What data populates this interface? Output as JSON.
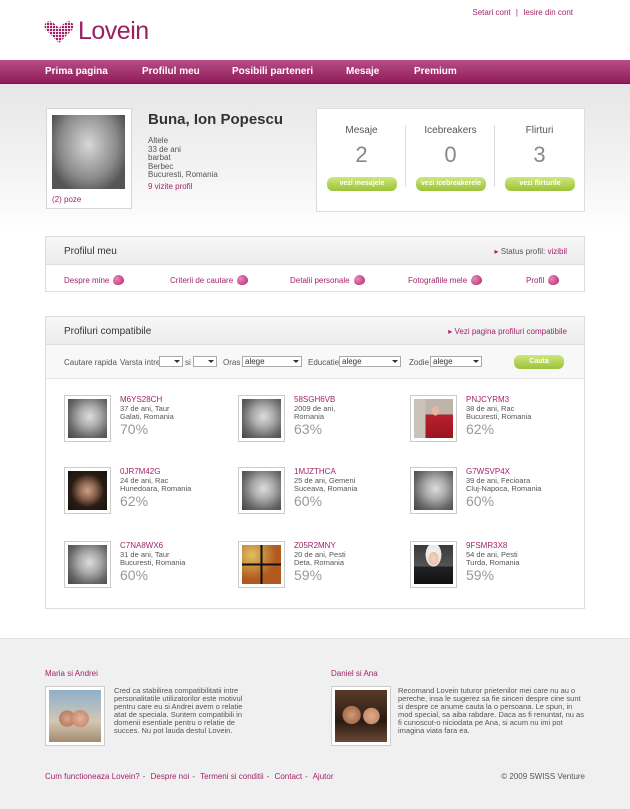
{
  "header": {
    "logo_text": "Lovein",
    "links": [
      "Setari cont",
      "Iesire din cont"
    ],
    "brand_color": "#9c1f61"
  },
  "nav": {
    "items": [
      "Prima pagina",
      "Profilul meu",
      "Posibili parteneri",
      "Mesaje",
      "Premium"
    ]
  },
  "user": {
    "greeting": "Buna, Ion Popescu",
    "info_lines": [
      "Altele",
      "33 de ani",
      "barbat",
      "Berbec",
      "Bucuresti, Romania"
    ],
    "visits": "9 vizite profil",
    "photos": "(2) poze"
  },
  "stats": [
    {
      "label": "Mesaje",
      "count": "2",
      "button": "vezi mesajele"
    },
    {
      "label": "Icebreakers",
      "count": "0",
      "button": "vezi icebreakerele"
    },
    {
      "label": "Flirturi",
      "count": "3",
      "button": "vezi flirturile"
    }
  ],
  "profile_section": {
    "title": "Profilul meu",
    "status_label": "Status profil:",
    "status_value": "vizibil",
    "links": [
      "Despre mine",
      "Criterii de cautare",
      "Detalii personale",
      "Fotografiile mele",
      "Profil"
    ]
  },
  "compatible": {
    "title": "Profiluri compatibile",
    "view_link": "Vezi pagina profiluri compatibile",
    "search": {
      "label": "Cautare rapida",
      "age_label": "Varsta intre",
      "and": "si",
      "city_label": "Oras",
      "city_value": "alege",
      "edu_label": "Educatie",
      "edu_value": "alege",
      "sign_label": "Zodie",
      "sign_value": "alege",
      "button": "Cauta"
    },
    "profiles": [
      {
        "code": "M6YS28CH",
        "line1": "37 de ani, Taur",
        "line2": "Galati, Romania",
        "match": "70%",
        "pic": "bw"
      },
      {
        "code": "58SGH6VB",
        "line1": "2009 de ani,",
        "line2": "Romania",
        "match": "63%",
        "pic": "bw"
      },
      {
        "code": "PNJCYRM3",
        "line1": "38 de ani, Rac",
        "line2": "Bucuresti, Romania",
        "match": "62%",
        "pic": "red"
      },
      {
        "code": "0JR7M42G",
        "line1": "24 de ani, Rac",
        "line2": "Hunedoara, Romania",
        "match": "62%",
        "pic": "dark"
      },
      {
        "code": "1MJZTHCA",
        "line1": "25 de ani, Gemeni",
        "line2": "Suceava, Romania",
        "match": "60%",
        "pic": "bw"
      },
      {
        "code": "G7WSVP4X",
        "line1": "39 de ani, Fecioara",
        "line2": "Cluj-Napoca, Romania",
        "match": "60%",
        "pic": "bw"
      },
      {
        "code": "C7NA8WX6",
        "line1": "31 de ani, Taur",
        "line2": "Bucuresti, Romania",
        "match": "60%",
        "pic": "bw"
      },
      {
        "code": "Z05R2MNY",
        "line1": "20 de ani, Pesti",
        "line2": "Deta, Romania",
        "match": "59%",
        "pic": "grid"
      },
      {
        "code": "9FSMR3X8",
        "line1": "54 de ani, Pesti",
        "line2": "Turda, Romania",
        "match": "59%",
        "pic": "woman"
      }
    ]
  },
  "testimonials": [
    {
      "names": "Maria si Andrei",
      "text": "Cred ca stabilirea compatibilitatii intre personalitatile utilizatorilor este motivul pentru care eu si Andrei avem o relatie atat de speciala. Suntem compatibili in domenii esentiale pentru o relatie de succes. Nu pot lauda destul Lovein."
    },
    {
      "names": "Daniel si Ana",
      "text": "Recomand Lovein tuturor prietenilor mei care nu au o pereche, insa le sugerez sa fie sinceri despre cine sunt si despre ce anume cauta la o persoana. Le spun, in mod special, sa aiba rabdare. Daca as fi renuntat, nu as fi cunoscut-o niciodata pe Ana, si acum nu imi pot imagina viata fara ea."
    }
  ],
  "footer": {
    "links": [
      "Cum functioneaza Lovein?",
      "Despre noi",
      "Termeni si conditii",
      "Contact",
      "Ajutor"
    ],
    "copyright": "© 2009 SWISS Venture"
  }
}
